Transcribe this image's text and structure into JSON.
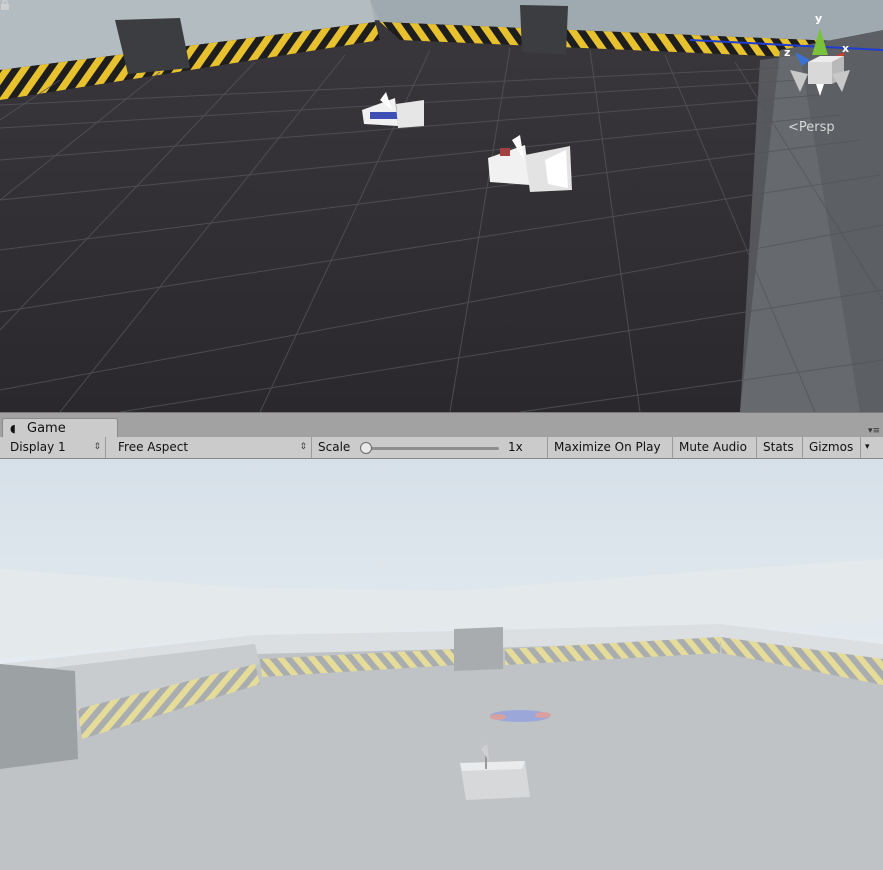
{
  "scene": {
    "gizmo": {
      "y_label": "y",
      "x_label": "x",
      "z_label": "z"
    },
    "projection_label": "Persp"
  },
  "game_tab": {
    "icon": "pacman-icon",
    "label": "Game"
  },
  "toolbar": {
    "display": "Display 1",
    "aspect": "Free Aspect",
    "scale_label": "Scale",
    "scale_value": "1x",
    "maximize_on_play": "Maximize On Play",
    "mute_audio": "Mute Audio",
    "stats": "Stats",
    "gizmos": "Gizmos"
  },
  "colors": {
    "scene_floor": "#2d2b2f",
    "hazard_yellow": "#e8c22e",
    "game_sky": "#dde7ef",
    "game_floor": "#bfc3c6",
    "gizmo_x": "#d33b2a",
    "gizmo_y": "#7ac13c",
    "gizmo_z": "#3a71d9"
  }
}
